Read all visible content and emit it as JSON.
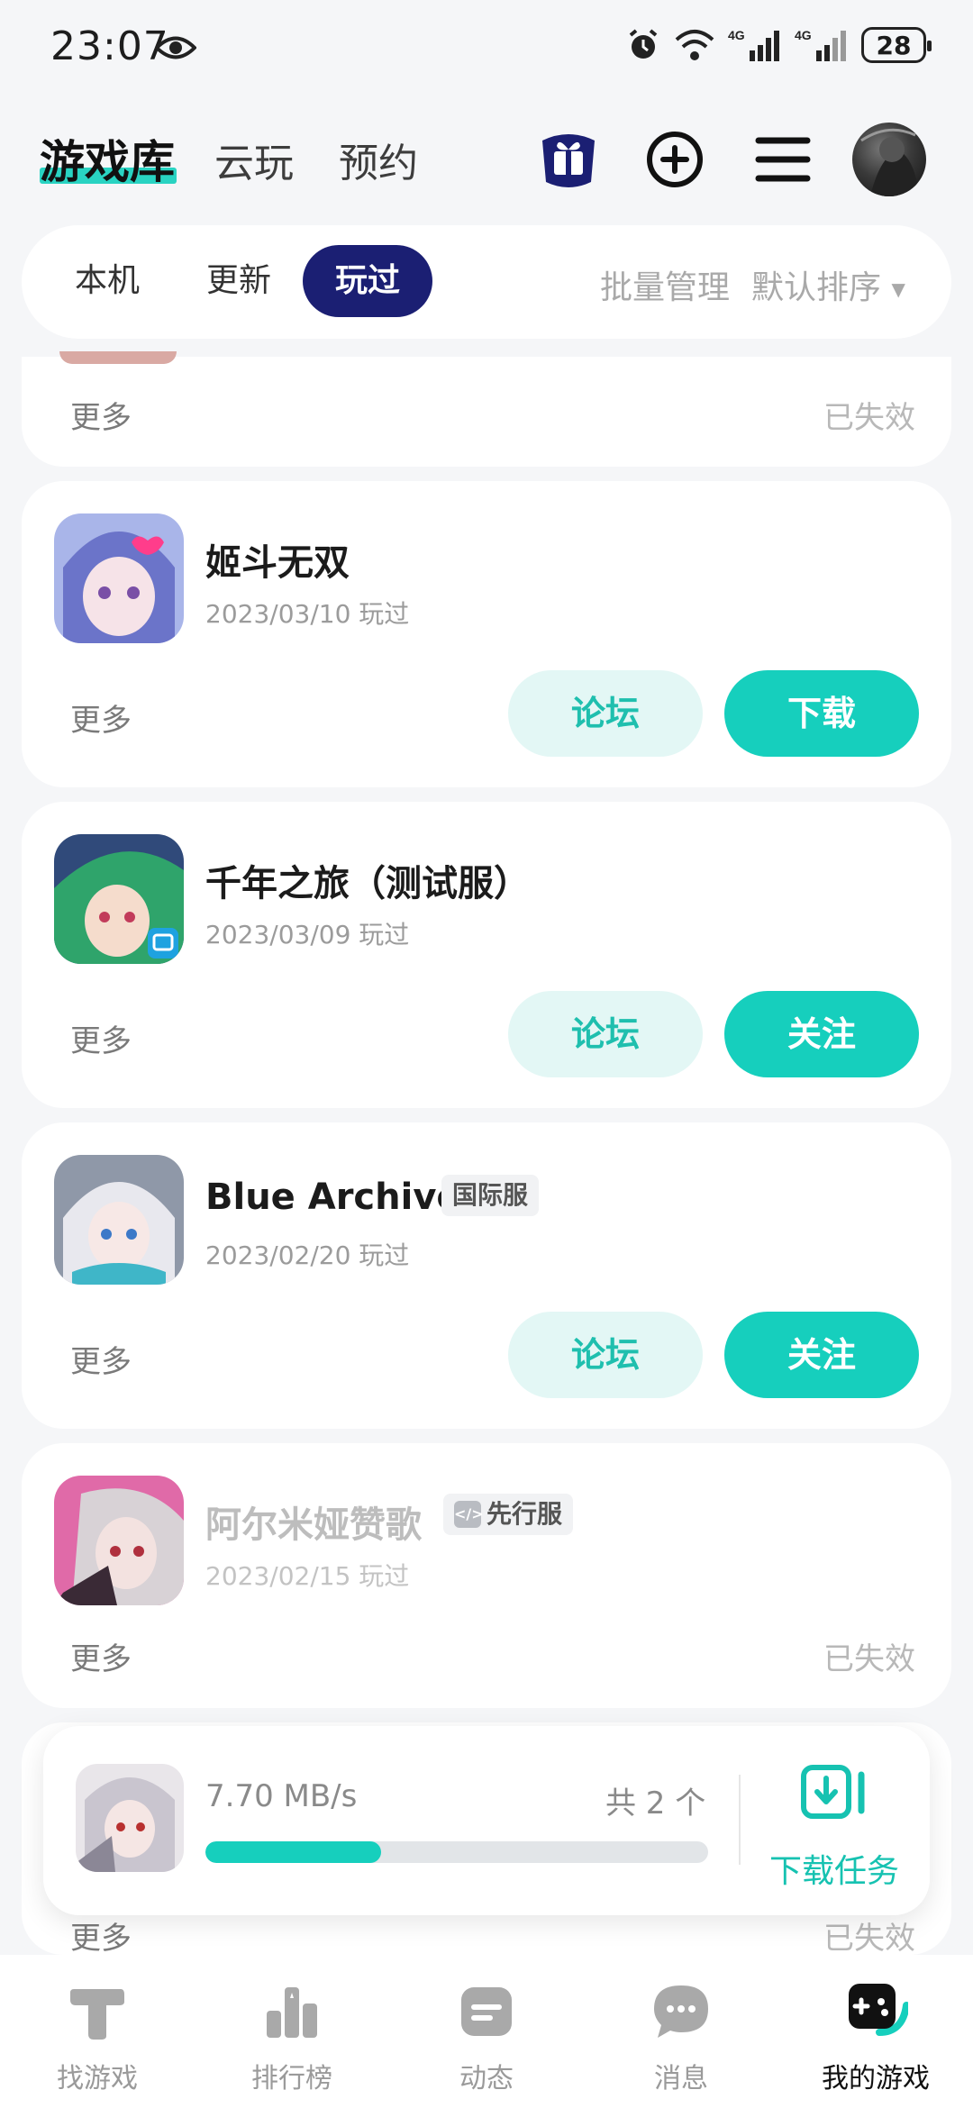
{
  "status_bar": {
    "time": "23:07",
    "battery": "28",
    "net1": "4G",
    "net2": "4G"
  },
  "header": {
    "tabs": [
      {
        "label": "游戏库",
        "active": true
      },
      {
        "label": "云玩",
        "active": false
      },
      {
        "label": "预约",
        "active": false
      }
    ]
  },
  "filter": {
    "chips": [
      {
        "label": "本机",
        "active": false
      },
      {
        "label": "更新",
        "active": false
      },
      {
        "label": "玩过",
        "active": true
      }
    ],
    "batch_manage": "批量管理",
    "sort": "默认排序"
  },
  "cards": [
    {
      "more": "更多",
      "status": "已失效"
    },
    {
      "title": "姬斗无双",
      "date": "2023/03/10 玩过",
      "more": "更多",
      "forum": "论坛",
      "action": "下载"
    },
    {
      "title": "千年之旅（测试服）",
      "date": "2023/03/09 玩过",
      "more": "更多",
      "forum": "论坛",
      "action": "关注"
    },
    {
      "title": "Blue Archive",
      "tag": "国际服",
      "date": "2023/02/20 玩过",
      "more": "更多",
      "forum": "论坛",
      "action": "关注"
    },
    {
      "title": "阿尔米娅赞歌",
      "tag": "先行服",
      "date": "2023/02/15 玩过",
      "more": "更多",
      "status": "已失效"
    },
    {
      "more": "更多",
      "status": "已失效"
    }
  ],
  "download": {
    "speed": "7.70 MB/s",
    "count": "共 2 个",
    "progress": 0.35,
    "task_label": "下载任务"
  },
  "bottom_nav": [
    {
      "label": "找游戏",
      "icon": "find-game-icon"
    },
    {
      "label": "排行榜",
      "icon": "ranking-icon"
    },
    {
      "label": "动态",
      "icon": "feed-icon"
    },
    {
      "label": "消息",
      "icon": "message-icon"
    },
    {
      "label": "我的游戏",
      "icon": "my-games-icon",
      "active": true
    }
  ],
  "colors": {
    "accent": "#16cfbd",
    "active_chip": "#1b1f73",
    "underline": "#29d3c2"
  }
}
